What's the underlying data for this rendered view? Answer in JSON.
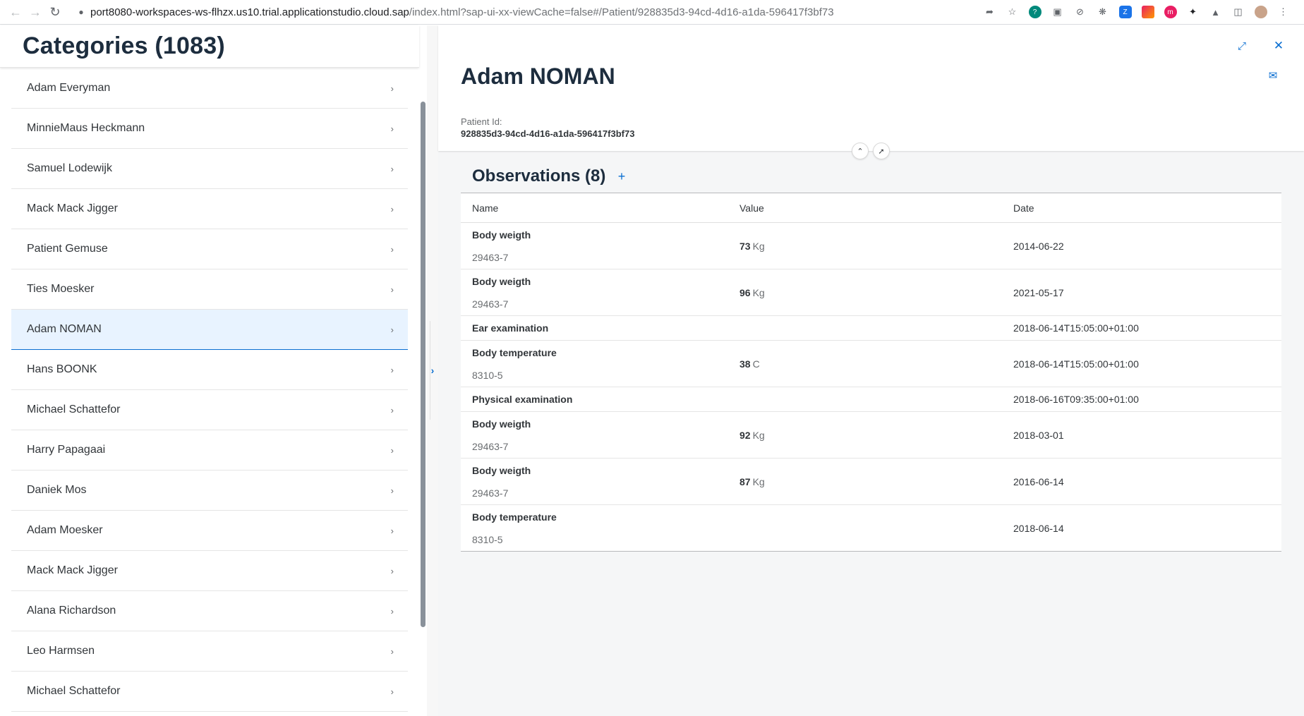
{
  "browser": {
    "url_host": "port8080-workspaces-ws-flhzx.us10.trial.applicationstudio.cloud.sap",
    "url_path": "/index.html?sap-ui-xx-viewCache=false#/Patient/928835d3-94cd-4d16-a1da-596417f3bf73"
  },
  "master": {
    "title": "Categories (1083)",
    "items": [
      {
        "label": "Adam Everyman"
      },
      {
        "label": "MinnieMaus Heckmann"
      },
      {
        "label": "Samuel Lodewijk"
      },
      {
        "label": "Mack Mack Jigger"
      },
      {
        "label": "Patient Gemuse"
      },
      {
        "label": "Ties Moesker"
      },
      {
        "label": "Adam NOMAN"
      },
      {
        "label": "Hans BOONK"
      },
      {
        "label": "Michael Schattefor"
      },
      {
        "label": "Harry Papagaai"
      },
      {
        "label": "Daniek Mos"
      },
      {
        "label": "Adam Moesker"
      },
      {
        "label": "Mack Mack Jigger"
      },
      {
        "label": "Alana Richardson"
      },
      {
        "label": "Leo Harmsen"
      },
      {
        "label": "Michael Schattefor"
      }
    ],
    "selected_index": 6
  },
  "detail": {
    "title": "Adam NOMAN",
    "patient_id_label": "Patient Id:",
    "patient_id": "928835d3-94cd-4d16-a1da-596417f3bf73",
    "observations_title": "Observations (8)",
    "add_label": "+",
    "columns": {
      "name": "Name",
      "value": "Value",
      "date": "Date"
    },
    "rows": [
      {
        "name": "Body weigth",
        "code": "29463-7",
        "value": "73",
        "unit": "Kg",
        "date": "2014-06-22"
      },
      {
        "name": "Body weigth",
        "code": "29463-7",
        "value": "96",
        "unit": "Kg",
        "date": "2021-05-17"
      },
      {
        "name": "Ear examination",
        "code": "",
        "value": "",
        "unit": "",
        "date": "2018-06-14T15:05:00+01:00"
      },
      {
        "name": "Body temperature",
        "code": "8310-5",
        "value": "38",
        "unit": "C",
        "date": "2018-06-14T15:05:00+01:00"
      },
      {
        "name": "Physical examination",
        "code": "",
        "value": "",
        "unit": "",
        "date": "2018-06-16T09:35:00+01:00"
      },
      {
        "name": "Body weigth",
        "code": "29463-7",
        "value": "92",
        "unit": "Kg",
        "date": "2018-03-01"
      },
      {
        "name": "Body weigth",
        "code": "29463-7",
        "value": "87",
        "unit": "Kg",
        "date": "2016-06-14"
      },
      {
        "name": "Body temperature",
        "code": "8310-5",
        "value": "",
        "unit": "",
        "date": "2018-06-14"
      }
    ]
  },
  "colors": {
    "accent": "#0a6ed1",
    "selected_bg": "#e8f3ff",
    "title_text": "#1d2d3e"
  }
}
